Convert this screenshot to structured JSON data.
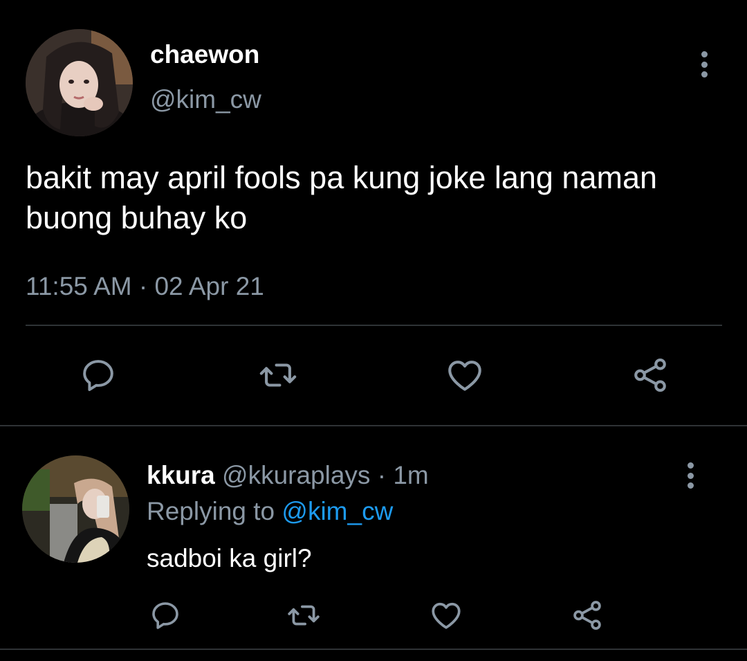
{
  "tweet": {
    "display_name": "chaewon",
    "handle": "@kim_cw",
    "text": "bakit may april fools pa kung joke lang naman buong buhay ko",
    "timestamp": "11:55 AM · 02 Apr 21",
    "actions": {
      "reply_icon": "speech-bubble-icon",
      "retweet_icon": "retweet-icon",
      "like_icon": "heart-icon",
      "share_icon": "share-icon"
    }
  },
  "reply": {
    "display_name": "kkura",
    "handle": "@kkuraplays",
    "separator": " · ",
    "time_ago": "1m",
    "replying_prefix": "Replying to ",
    "replying_to": "@kim_cw",
    "text": "sadboi ka girl?"
  },
  "colors": {
    "background": "#000000",
    "primary_text": "#ffffff",
    "secondary_text": "#8b98a5",
    "mention": "#1d9bf0",
    "divider": "#2f3336"
  }
}
